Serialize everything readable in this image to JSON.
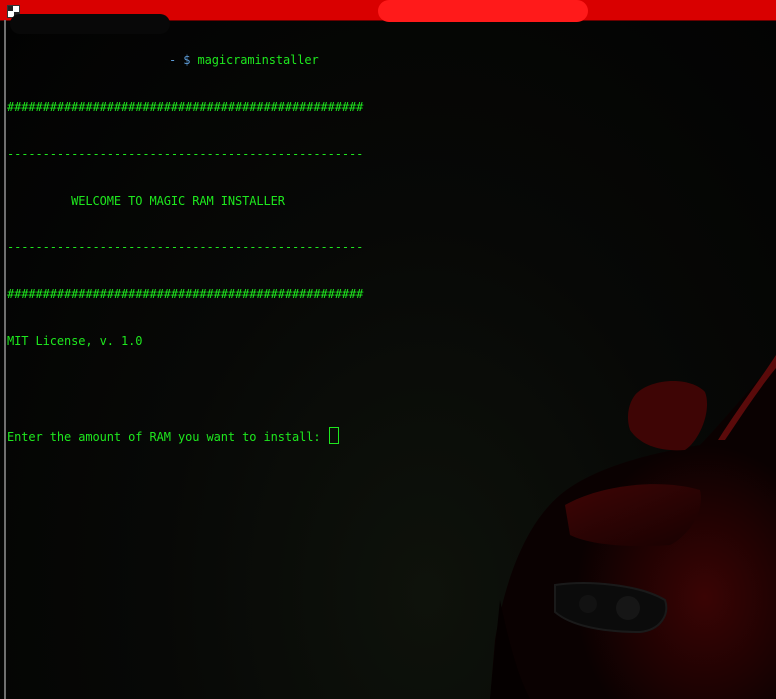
{
  "terminal": {
    "prompt_symbol": "- $",
    "command": "magicraminstaller",
    "lines": [
      "##################################################",
      "--------------------------------------------------",
      "         WELCOME TO MAGIC RAM INSTALLER",
      "--------------------------------------------------",
      "##################################################",
      "MIT License, v. 1.0",
      "",
      "Enter the amount of RAM you want to install: "
    ]
  },
  "colors": {
    "titlebar": "#d90000",
    "text": "#1ee81e",
    "prompt": "#5c9bd6",
    "background": "#050505",
    "car_red": "#7a0a0a"
  },
  "icons": {
    "app": "terminal-app-icon",
    "background": "red-car-wallpaper"
  }
}
